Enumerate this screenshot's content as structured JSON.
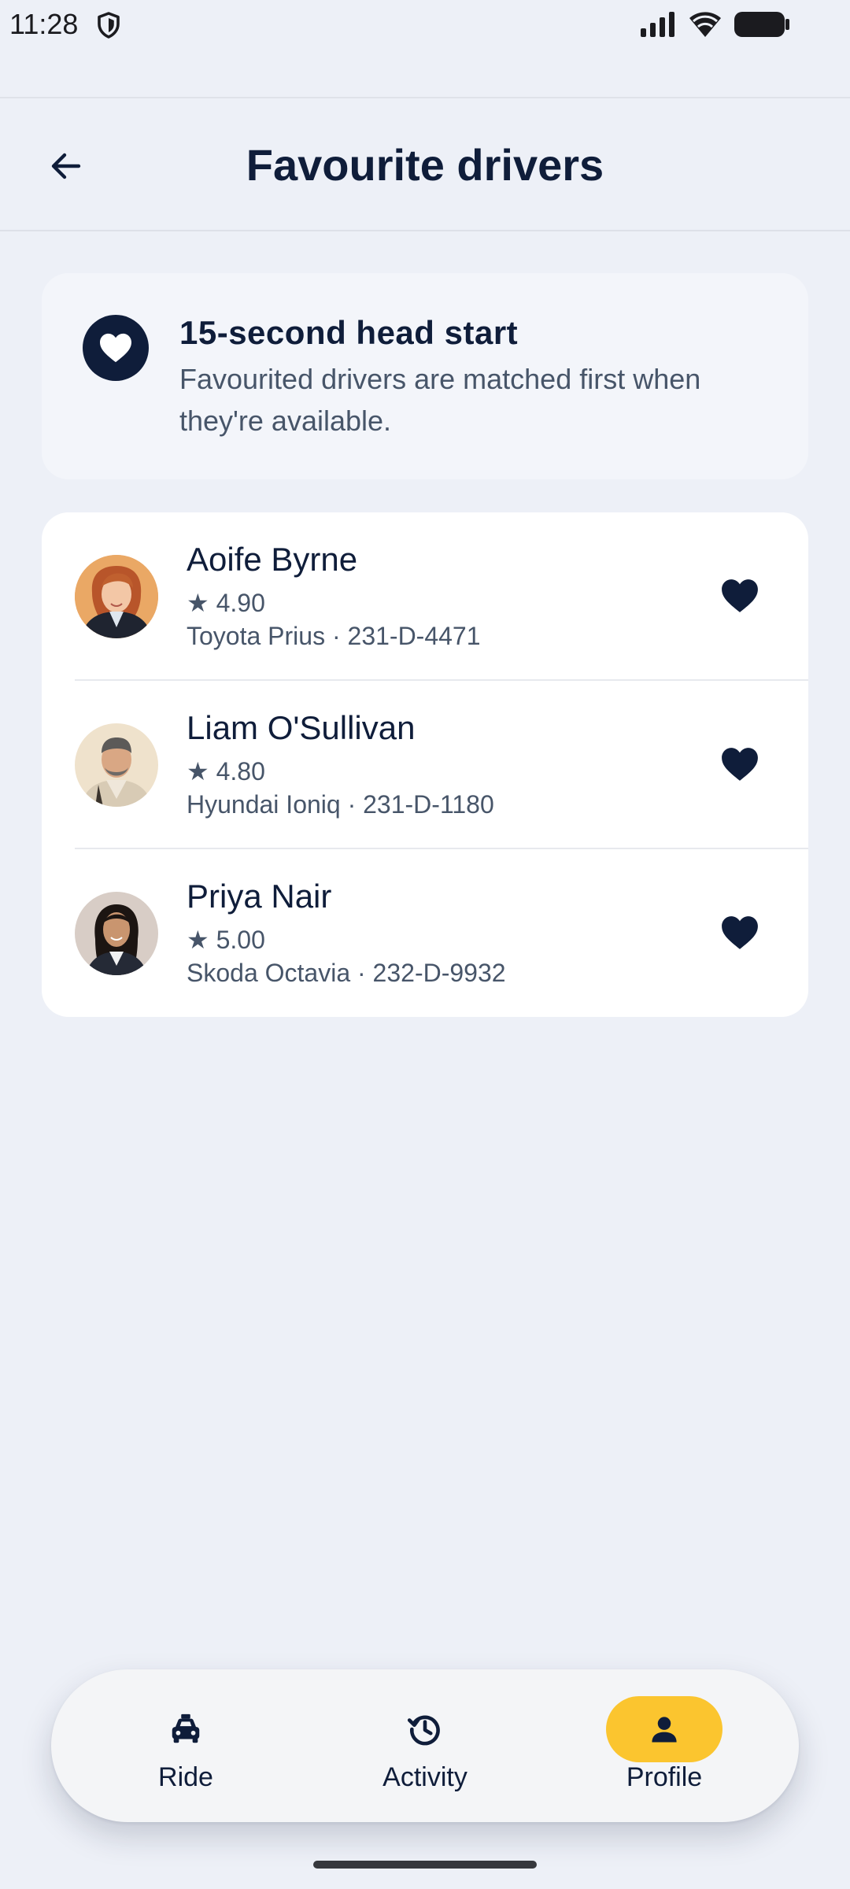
{
  "status_bar": {
    "time": "11:28"
  },
  "header": {
    "title": "Favourite drivers"
  },
  "info_card": {
    "icon": "heart-icon",
    "title": "15-second head start",
    "description": "Favourited drivers are matched first when they're available."
  },
  "drivers": [
    {
      "name": "Aoife Byrne",
      "rating": "★ 4.90",
      "vehicle": "Toyota Prius · 231-D-4471",
      "favourite": true
    },
    {
      "name": "Liam O'Sullivan",
      "rating": "★ 4.80",
      "vehicle": "Hyundai Ioniq · 231-D-1180",
      "favourite": true
    },
    {
      "name": "Priya Nair",
      "rating": "★ 5.00",
      "vehicle": "Skoda Octavia · 232-D-9932",
      "favourite": true
    }
  ],
  "bottom_nav": {
    "items": [
      {
        "label": "Ride",
        "icon": "taxi-icon",
        "active": false
      },
      {
        "label": "Activity",
        "icon": "history-icon",
        "active": false
      },
      {
        "label": "Profile",
        "icon": "person-icon",
        "active": true
      }
    ]
  },
  "colors": {
    "background": "#edf0f7",
    "primary": "#0f1d3a",
    "accent": "#fbc52f",
    "secondary_text": "#475569"
  }
}
